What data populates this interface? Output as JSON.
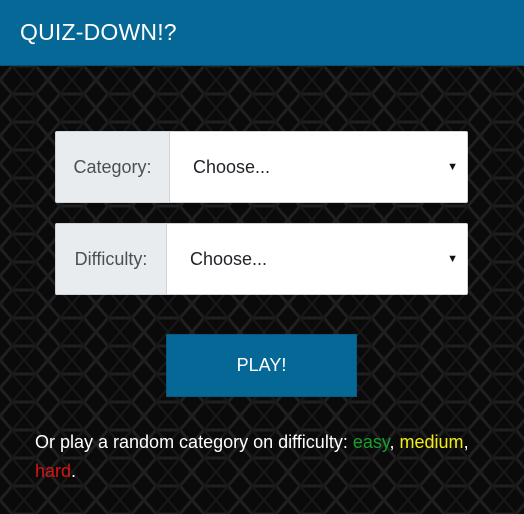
{
  "header": {
    "title": "QUIZ-DOWN!?"
  },
  "form": {
    "category": {
      "label": "Category:",
      "selected": "Choose..."
    },
    "difficulty": {
      "label": "Difficulty:",
      "selected": "Choose..."
    },
    "play_label": "PLAY!"
  },
  "random": {
    "prefix": "Or play a random category on difficulty: ",
    "easy": "easy",
    "sep1": ", ",
    "medium": "medium",
    "sep2": ", ",
    "hard": "hard",
    "suffix": "."
  },
  "icons": {
    "caret": "caret-down-icon"
  },
  "colors": {
    "header_bg": "#066896",
    "button_bg": "#066896",
    "background": "#0a0a0a",
    "easy": "#16a12c",
    "medium": "#f2ee15",
    "hard": "#d81515"
  }
}
